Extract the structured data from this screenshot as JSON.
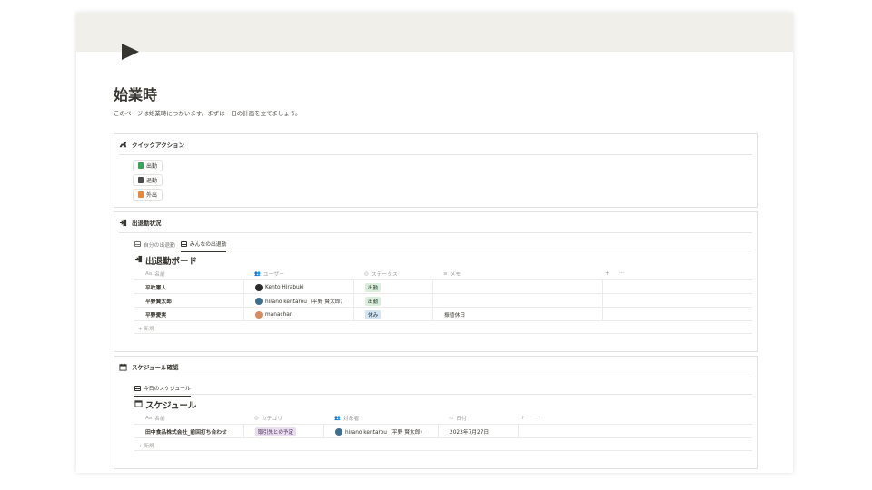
{
  "page": {
    "title": "始業時",
    "description": "このページは始業時につかいます。まずは一日の計画を立てましょう。"
  },
  "quick_actions": {
    "title": "クイックアクション",
    "buttons": [
      {
        "label": "出勤",
        "color": "#3aa55a"
      },
      {
        "label": "退勤",
        "color": "#4a4a4a"
      },
      {
        "label": "外出",
        "color": "#e8893a"
      }
    ]
  },
  "attendance": {
    "title": "出退勤状況",
    "tabs": [
      "自分の出退勤",
      "みんなの出退勤"
    ],
    "board_title": "出退勤ボード",
    "columns": [
      "名前",
      "ユーザー",
      "ステータス",
      "メモ"
    ],
    "header_extras": {
      "add": "+",
      "more": "···"
    },
    "rows": [
      {
        "name": "平吹憲人",
        "user": "Kento Hirabuki",
        "status": "出勤",
        "memo": ""
      },
      {
        "name": "平野賢太郎",
        "user": "hirano kentarou（平野 賢太郎）",
        "status": "出勤",
        "memo": ""
      },
      {
        "name": "平野愛実",
        "user": "manachan",
        "status": "休み",
        "memo": "振替休日"
      }
    ],
    "new_label": "+ 新規"
  },
  "schedule": {
    "title": "スケジュール確認",
    "tabs": [
      "今日のスケジュール"
    ],
    "board_title": "スケジュール",
    "columns": [
      "名前",
      "カテゴリ",
      "対象者",
      "日付"
    ],
    "header_extras": {
      "add": "+",
      "more": "···"
    },
    "rows": [
      {
        "name": "田中食品株式会社_前回打ち合わせ",
        "category": "取引先との予定",
        "target": "hirano kentarou（平野 賢太郎）",
        "date": "2023年7月27日"
      }
    ],
    "new_label": "+ 新規"
  },
  "colors": {
    "cover": "#f1efe9",
    "status_work_bg": "#dbeddb",
    "status_work_text": "#1c3829",
    "status_rest_bg": "#d3e5ef",
    "status_rest_text": "#183347",
    "category_bg": "#e8deee",
    "category_text": "#412454"
  }
}
